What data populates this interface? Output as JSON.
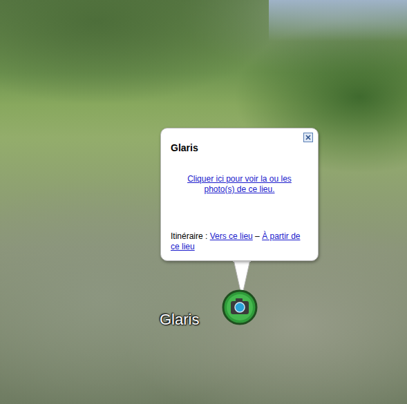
{
  "map": {
    "placemark": {
      "label": "Glaris"
    }
  },
  "balloon": {
    "title": "Glaris",
    "photo_link": "Cliquer ici pour voir la ou les photo(s) de ce lieu.",
    "directions": {
      "label": "Itinéraire :",
      "separator": "–",
      "to": "Vers ce lieu",
      "from": "À partir de ce lieu"
    }
  }
}
